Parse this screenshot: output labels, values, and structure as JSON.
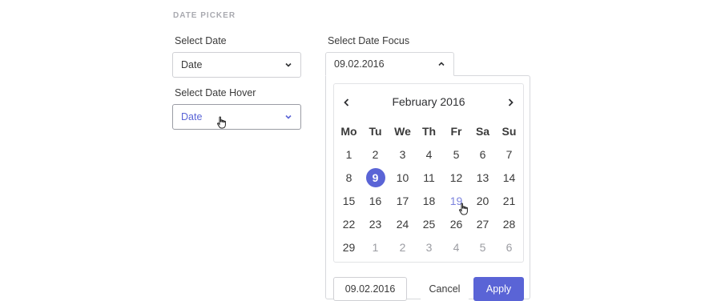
{
  "section": {
    "title": "DATE PICKER"
  },
  "select_date": {
    "label": "Select Date",
    "value": "Date"
  },
  "select_date_hover": {
    "label": "Select Date Hover",
    "value": "Date"
  },
  "select_date_focus": {
    "label": "Select Date Focus",
    "value": "09.02.2016"
  },
  "calendar": {
    "month_label": "February 2016",
    "weekdays": [
      "Mo",
      "Tu",
      "We",
      "Th",
      "Fr",
      "Sa",
      "Su"
    ],
    "weeks": [
      [
        "1",
        "2",
        "3",
        "4",
        "5",
        "6",
        "7"
      ],
      [
        "8",
        "9",
        "10",
        "11",
        "12",
        "13",
        "14"
      ],
      [
        "15",
        "16",
        "17",
        "18",
        "19",
        "20",
        "21"
      ],
      [
        "22",
        "23",
        "24",
        "25",
        "26",
        "27",
        "28"
      ],
      [
        "29",
        "1",
        "2",
        "3",
        "4",
        "5",
        "6"
      ]
    ],
    "selected_day": "9",
    "hovered_day": "19"
  },
  "footer": {
    "date_value": "09.02.2016",
    "cancel_label": "Cancel",
    "apply_label": "Apply"
  },
  "colors": {
    "accent": "#5a64d6",
    "hover_text": "#7b82dd",
    "muted": "#9b9ca2"
  },
  "icons": {
    "dropdown": "chevron-down-icon",
    "dropdown_open": "chevron-up-icon",
    "prev": "chevron-left-icon",
    "next": "chevron-right-icon",
    "cursor": "hand-pointer-icon"
  }
}
